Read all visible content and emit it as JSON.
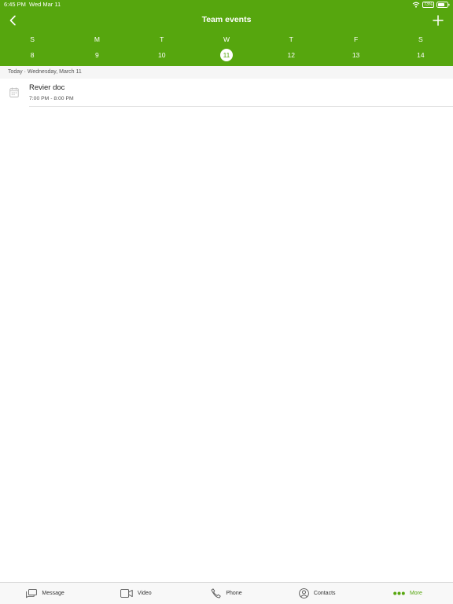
{
  "status": {
    "time": "6:45 PM",
    "date": "Wed Mar 11",
    "battery": "73%"
  },
  "nav": {
    "title": "Team events"
  },
  "week": [
    {
      "letter": "S",
      "num": "8",
      "selected": false
    },
    {
      "letter": "M",
      "num": "9",
      "selected": false
    },
    {
      "letter": "T",
      "num": "10",
      "selected": false
    },
    {
      "letter": "W",
      "num": "11",
      "selected": true
    },
    {
      "letter": "T",
      "num": "12",
      "selected": false
    },
    {
      "letter": "F",
      "num": "13",
      "selected": false
    },
    {
      "letter": "S",
      "num": "14",
      "selected": false
    }
  ],
  "section": {
    "label": "Today · Wednesday, March 11"
  },
  "events": [
    {
      "title": "Revier doc",
      "time": "7:00 PM - 8:00 PM",
      "icon": "calendar-icon"
    }
  ],
  "tabs": [
    {
      "label": "Message",
      "icon": "message-icon",
      "active": false
    },
    {
      "label": "Video",
      "icon": "video-icon",
      "active": false
    },
    {
      "label": "Phone",
      "icon": "phone-icon",
      "active": false
    },
    {
      "label": "Contacts",
      "icon": "contacts-icon",
      "active": false
    },
    {
      "label": "More",
      "icon": "more-icon",
      "active": true
    }
  ],
  "colors": {
    "accent": "#56a60e",
    "header_text": "#ffffff",
    "section_bg": "#f6f6f6",
    "tabbar_bg": "#f8f8f8"
  }
}
